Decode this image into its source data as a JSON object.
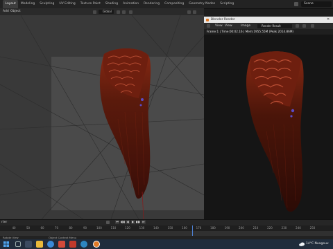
{
  "workspace_tabs": [
    "Layout",
    "Modeling",
    "Sculpting",
    "UV Editing",
    "Texture Paint",
    "Shading",
    "Animation",
    "Rendering",
    "Compositing",
    "Geometry Nodes",
    "Scripting"
  ],
  "scene": {
    "name": "Scene"
  },
  "viewport_header": {
    "menus": [
      "Add",
      "Object"
    ],
    "transform_orientation": "Global"
  },
  "render_window": {
    "title": "Blender Render",
    "menus": [
      "View",
      "View",
      "Image"
    ],
    "result_slot": "Render Result",
    "status": "Frame:1 | Time:00:02.16 | Mem:1955.55M (Peak 2014.86M)"
  },
  "timeline": {
    "frame_label": "rter",
    "ticks": [
      "40",
      "50",
      "60",
      "70",
      "80",
      "90",
      "100",
      "110",
      "120",
      "130",
      "140",
      "150",
      "160",
      "170",
      "180",
      "190",
      "200",
      "210",
      "220",
      "230",
      "240",
      "250"
    ],
    "controls": [
      "⏮",
      "◀◀",
      "◀",
      "▶",
      "▶▶",
      "⏭"
    ]
  },
  "statusbar": {
    "left": "Rotate View",
    "middle": "Object Context Menu"
  },
  "taskbar": {
    "weather": "14°C  Nuageux"
  },
  "colors": {
    "accent": "#4d7fd0",
    "hair_dark": "#3a0e08",
    "hair_mid": "#8a2a14",
    "hair_highlight": "#c4553a",
    "viewport_bg": "#393939",
    "render_bg": "#151515"
  }
}
